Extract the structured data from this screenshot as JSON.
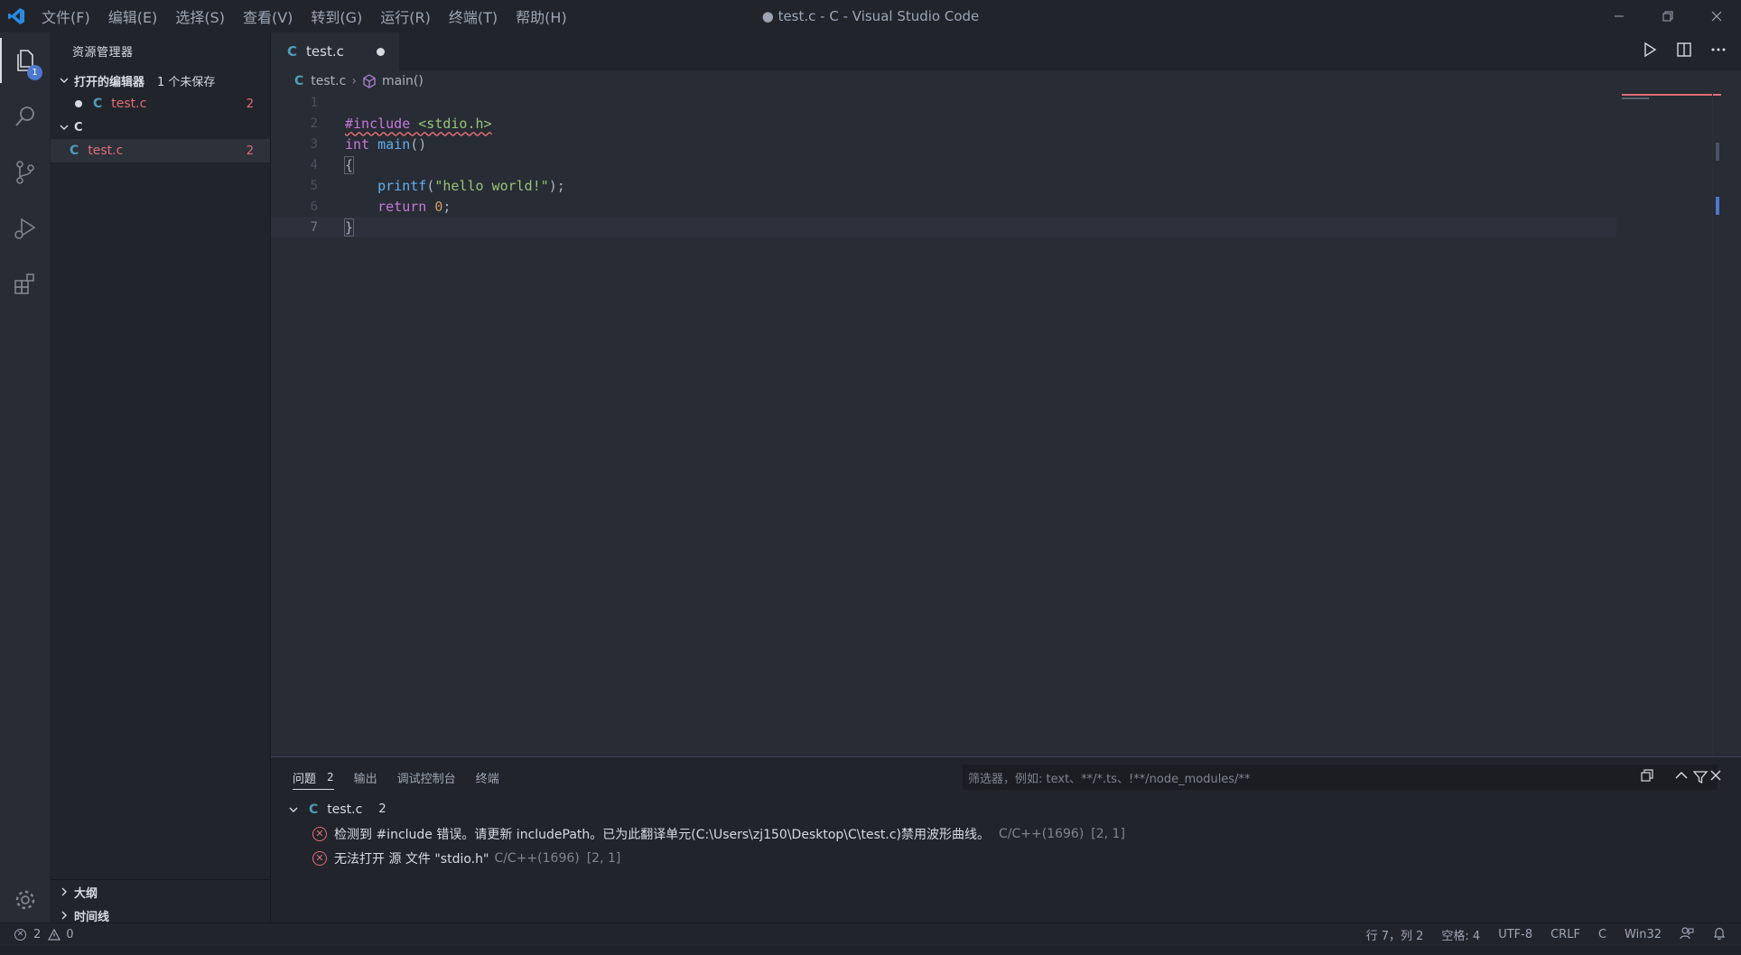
{
  "window": {
    "title": "● test.c - C - Visual Studio Code",
    "menu": [
      "文件(F)",
      "编辑(E)",
      "选择(S)",
      "查看(V)",
      "转到(G)",
      "运行(R)",
      "终端(T)",
      "帮助(H)"
    ]
  },
  "activity_bar": {
    "explorer_badge": "1",
    "items": [
      "explorer-icon",
      "search-icon",
      "source-control-icon",
      "run-debug-icon",
      "extensions-icon"
    ],
    "bottom": [
      "gear-icon"
    ]
  },
  "sidebar": {
    "title": "资源管理器",
    "open_editors": {
      "label": "打开的编辑器",
      "unsaved": "1 个未保存",
      "files": [
        {
          "icon": "C",
          "name": "test.c",
          "errors": "2"
        }
      ]
    },
    "folder": {
      "label": "C",
      "files": [
        {
          "icon": "C",
          "name": "test.c",
          "errors": "2"
        }
      ]
    },
    "outline_label": "大纲",
    "timeline_label": "时间线"
  },
  "tabs": [
    {
      "icon": "C",
      "name": "test.c",
      "dirty": true
    }
  ],
  "breadcrumb": {
    "file": "test.c",
    "symbol": "main()"
  },
  "editor": {
    "line_numbers": [
      "1",
      "2",
      "3",
      "4",
      "5",
      "6",
      "7"
    ],
    "lines": [
      "",
      "#include <stdio.h>",
      "int main()",
      "{",
      "    printf(\"hello world!\");",
      "    return 0;",
      "}"
    ],
    "current_line": 7
  },
  "panel": {
    "tabs": [
      {
        "label": "问题",
        "count": "2",
        "active": true
      },
      {
        "label": "输出"
      },
      {
        "label": "调试控制台"
      },
      {
        "label": "终端"
      }
    ],
    "filter_placeholder": "筛选器，例如: text、**/*.ts、!**/node_modules/**",
    "problems": {
      "file": "test.c",
      "file_icon": "C",
      "count": "2",
      "items": [
        {
          "message": "检测到 #include 错误。请更新 includePath。已为此翻译单元(C:\\Users\\zj150\\Desktop\\C\\test.c)禁用波形曲线。",
          "source": "C/C++(1696)",
          "position": "[2, 1]"
        },
        {
          "message": "无法打开 源 文件 \"stdio.h\"",
          "source": "C/C++(1696)",
          "position": "[2, 1]"
        }
      ]
    }
  },
  "status_bar": {
    "errors": "2",
    "warnings": "0",
    "position": "行 7，列 2",
    "spaces": "空格: 4",
    "encoding": "UTF-8",
    "eol": "CRLF",
    "language": "C",
    "platform": "Win32"
  },
  "colors": {
    "accent": "#4d78cc",
    "error": "#e06c75",
    "c_icon": "#519aba"
  }
}
